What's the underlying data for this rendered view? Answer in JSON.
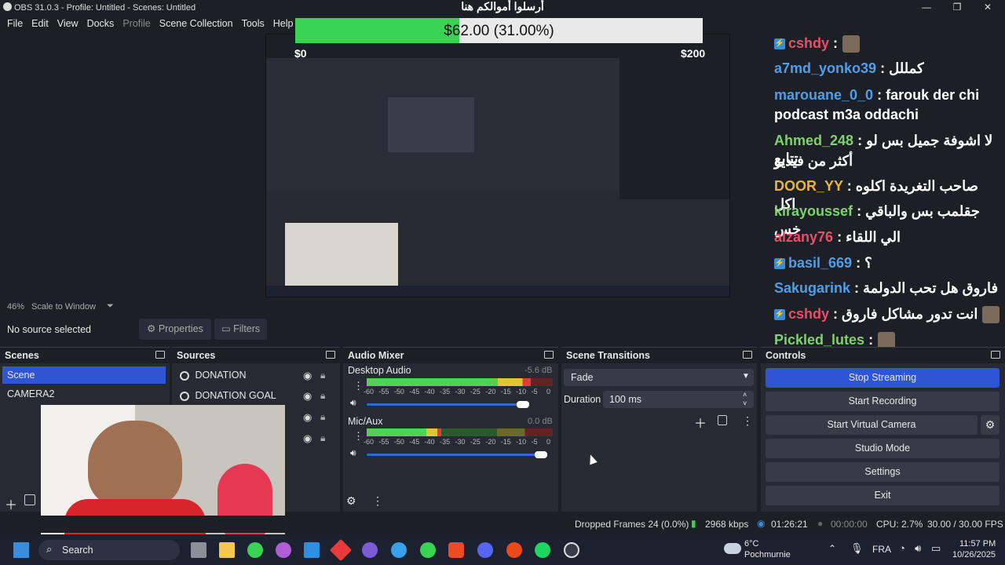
{
  "window": {
    "title": "OBS 31.0.3 - Profile: Untitled - Scenes: Untitled",
    "banner": "أرسلوا أموالكم هنا"
  },
  "menu": [
    "File",
    "Edit",
    "View",
    "Docks",
    "Profile",
    "Scene Collection",
    "Tools",
    "Help"
  ],
  "donation": {
    "text": "$62.00 (31.00%)",
    "progress_fraction": 0.31,
    "min_label": "$0",
    "max_label": "$200"
  },
  "preview": {
    "zoom": "46%",
    "scale_mode": "Scale to Window"
  },
  "chat": [
    {
      "user": "cshdy",
      "msg": ":",
      "badge": true,
      "avatar": true,
      "color": "#e84d6a"
    },
    {
      "user": "a7md_yonko39",
      "msg": ": كمللل",
      "color": "#4e9fe8"
    },
    {
      "user": "marouane_0_0",
      "msg": ": farouk der chi",
      "color": "#4e9fe8"
    },
    {
      "user": "",
      "msg": "podcast m3a oddachi",
      "color": "#ffffff"
    },
    {
      "user": "Ahmed_248",
      "msg": ": لا اشوفة جميل بس لو تتابع",
      "color": "#7ed36b"
    },
    {
      "user": "",
      "msg": "أكثر من فيديو",
      "color": "#ffffff"
    },
    {
      "user": "DOOR_YY",
      "msg": ": صاحب التغريدة اكلوه اكل",
      "color": "#e8b53c"
    },
    {
      "user": "kirayoussef",
      "msg": ": جقلمب بس والباقي خس",
      "color": "#7ed36b"
    },
    {
      "user": "alzany76",
      "msg": ": الي اللقاء",
      "color": "#e84d6a"
    },
    {
      "user": "basil_669",
      "msg": ": ؟",
      "badge": true,
      "color": "#4e9fe8"
    },
    {
      "user": "Sakugarink",
      "msg": ": فاروق هل تحب الدولمة",
      "color": "#4e9fe8"
    },
    {
      "user": "cshdy",
      "msg": ": انت تدور مشاكل فاروق",
      "badge": true,
      "avatar": true,
      "color": "#e84d6a"
    },
    {
      "user": "Pickled_lutes",
      "msg": ":",
      "avatar": true,
      "color": "#7ed36b"
    }
  ],
  "props": {
    "no_source": "No source selected",
    "properties": "Properties",
    "filters": "Filters"
  },
  "scenes": {
    "title": "Scenes",
    "items": [
      "Scene",
      "CAMERA2"
    ]
  },
  "sources": {
    "title": "Sources",
    "items": [
      "DONATION",
      "DONATION GOAL"
    ]
  },
  "mixer": {
    "title": "Audio Mixer",
    "scale": [
      "-60",
      "-55",
      "-50",
      "-45",
      "-40",
      "-35",
      "-30",
      "-25",
      "-20",
      "-15",
      "-10",
      "-5",
      "0"
    ],
    "channels": [
      {
        "name": "Desktop Audio",
        "db": "-5.6 dB",
        "level": 0.88,
        "volume": 0.9
      },
      {
        "name": "Mic/Aux",
        "db": "0.0 dB",
        "level": 0.4,
        "volume": 1.0
      }
    ]
  },
  "transitions": {
    "title": "Scene Transitions",
    "selected": "Fade",
    "duration_label": "Duration",
    "duration_value": "100 ms"
  },
  "controls": {
    "title": "Controls",
    "stop_streaming": "Stop Streaming",
    "start_recording": "Start Recording",
    "start_virtual_camera": "Start Virtual Camera",
    "studio_mode": "Studio Mode",
    "settings": "Settings",
    "exit": "Exit"
  },
  "status": {
    "dropped": "Dropped Frames 24 (0.0%)",
    "kbps": "2968 kbps",
    "stream_time": "01:26:21",
    "rec_time": "00:00:00",
    "cpu": "CPU: 2.7%",
    "fps": "30.00 / 30.00 FPS"
  },
  "taskbar": {
    "search": "Search",
    "weather_temp": "6°C",
    "weather_place": "Pochmurnie",
    "lang": "FRA",
    "time": "11:57 PM",
    "date": "10/26/2025"
  },
  "colors": {
    "accent": "#2f55d4",
    "green": "#39d253"
  }
}
